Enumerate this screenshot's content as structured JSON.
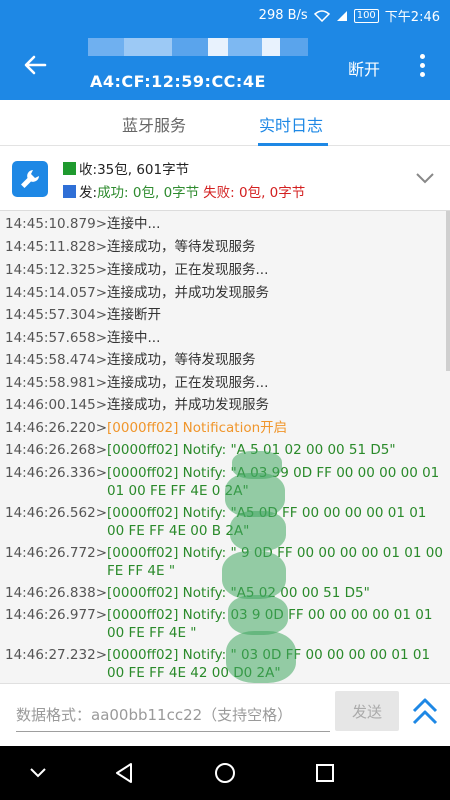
{
  "status_bar": {
    "network_speed": "298 B/s",
    "battery": "100",
    "time": "下午2:46"
  },
  "app_bar": {
    "device_mac": "A4:CF:12:59:CC:4E",
    "disconnect_label": "断开"
  },
  "tabs": [
    {
      "label": "蓝牙服务",
      "active": false
    },
    {
      "label": "实时日志",
      "active": true
    }
  ],
  "stats": {
    "receive_prefix": "收:",
    "receive_value": "35包, 601字节",
    "send_prefix": "发:",
    "success_label": "成功: 0包, 0字节",
    "fail_label": "失败: 0包, 0字节",
    "colors": {
      "receive": "#1f9a2e",
      "send": "#2f6fd6",
      "success": "#2e8b2e",
      "fail": "#d32020"
    }
  },
  "log": [
    {
      "ts": "14:45:10.879>",
      "msg": "连接中...",
      "style": "normal"
    },
    {
      "ts": "14:45:11.828>",
      "msg": "连接成功，等待发现服务",
      "style": "normal"
    },
    {
      "ts": "14:45:12.325>",
      "msg": "连接成功，正在发现服务...",
      "style": "normal"
    },
    {
      "ts": "14:45:14.057>",
      "msg": "连接成功，并成功发现服务",
      "style": "normal"
    },
    {
      "ts": "14:45:57.304>",
      "msg": "连接断开",
      "style": "normal"
    },
    {
      "ts": "14:45:57.658>",
      "msg": "连接中...",
      "style": "normal"
    },
    {
      "ts": "14:45:58.474>",
      "msg": "连接成功，等待发现服务",
      "style": "normal"
    },
    {
      "ts": "14:45:58.981>",
      "msg": "连接成功，正在发现服务...",
      "style": "normal"
    },
    {
      "ts": "14:46:00.145>",
      "msg": "连接成功，并成功发现服务",
      "style": "normal"
    },
    {
      "ts": "14:46:26.220>",
      "msg": "[0000ff02] Notification开启",
      "style": "orange"
    },
    {
      "ts": "14:46:26.268>",
      "msg": "[0000ff02] Notify: \"A        5 01 02 00 00 51 D5\"",
      "style": "green"
    },
    {
      "ts": "14:46:26.336>",
      "msg": "[0000ff02] Notify: \"A     03 99 0D FF 00 00 00 00 01 01 00 FE FF 4E        0 2A\"",
      "style": "green"
    },
    {
      "ts": "14:46:26.562>",
      "msg": "[0000ff02] Notify: \"A5         0D FF 00 00 00 00 01 01 00 FE FF 4E     00 B   2A\"",
      "style": "green"
    },
    {
      "ts": "14:46:26.772>",
      "msg": "[0000ff02] Notify: \"        9 0D FF 00 00 00 00 01 01 00 FE FF 4E    \"",
      "style": "green"
    },
    {
      "ts": "14:46:26.838>",
      "msg": "[0000ff02] Notify: \"A5          02 00 00 51 D5\"",
      "style": "green"
    },
    {
      "ts": "14:46:26.977>",
      "msg": "[0000ff02] Notify:      03 9 0D FF 00 00 00 00 01 01 00 FE FF 4E       \"",
      "style": "green"
    },
    {
      "ts": "14:46:27.232>",
      "msg": "[0000ff02] Notify: \"     03    0D FF 00 00 00 00 01 01 00 FE FF 4E 42 00 D0 2A\"",
      "style": "green"
    }
  ],
  "input": {
    "placeholder": "数据格式：aa00bb11cc22（支持空格）",
    "value": ""
  },
  "send_label": "发送",
  "icons": {
    "back": "arrow-left-icon",
    "more": "more-vert-icon",
    "tool": "wrench-icon",
    "expand": "chevron-down-icon",
    "scroll_up": "double-chevron-up-icon"
  },
  "colors": {
    "primary": "#1e88e5",
    "log_green": "#2a8a2a",
    "log_orange": "#f0962c"
  }
}
